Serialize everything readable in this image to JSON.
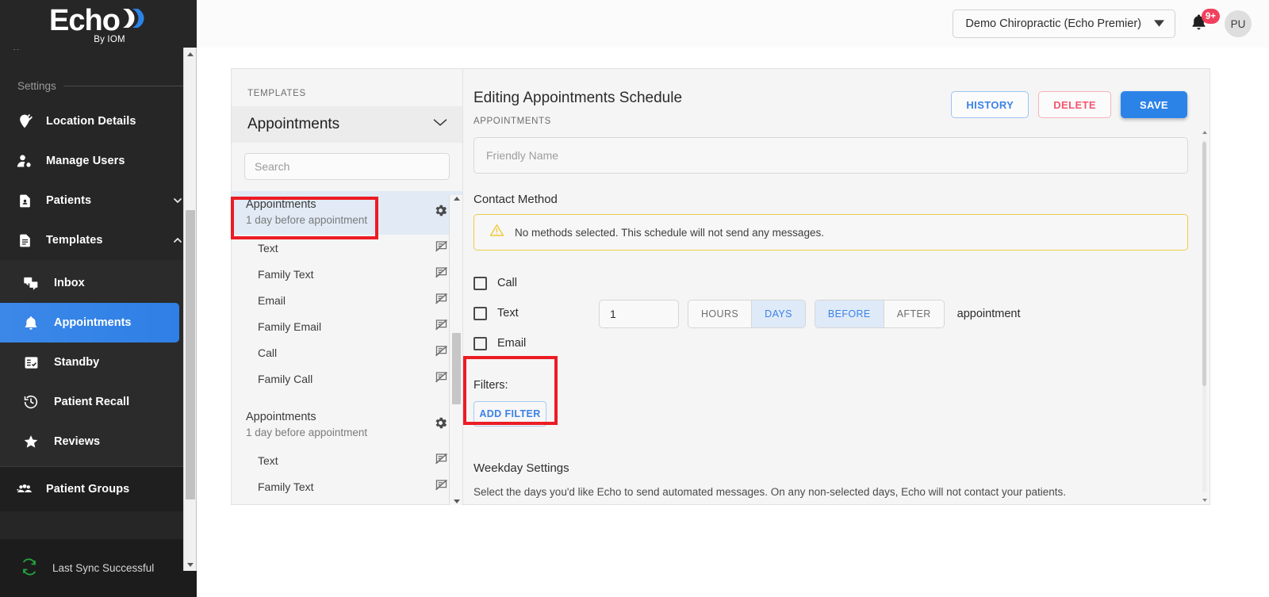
{
  "brand": {
    "logo_text": "Echo",
    "logo_sub": "By IOM",
    "accent_blue": "#2b83e8",
    "sidebar_bg": "#262626",
    "annotation_red": "#ec1c24",
    "warning_yellow": "#e9cd4a"
  },
  "sidebar": {
    "group_label": "Settings",
    "items": [
      {
        "label": "Location Details",
        "icon": "location-pin-edit-icon",
        "chevron": ""
      },
      {
        "label": "Manage Users",
        "icon": "user-gear-icon",
        "chevron": ""
      },
      {
        "label": "Patients",
        "icon": "patient-document-icon",
        "chevron": "chevron-down-icon"
      },
      {
        "label": "Templates",
        "icon": "template-document-icon",
        "chevron": "chevron-up-icon"
      }
    ],
    "sub_items": [
      {
        "label": "Inbox",
        "icon": "chat-bubbles-icon",
        "active": false
      },
      {
        "label": "Appointments",
        "icon": "bell-icon",
        "active": true
      },
      {
        "label": "Standby",
        "icon": "checklist-icon",
        "active": false
      },
      {
        "label": "Patient Recall",
        "icon": "history-clock-icon",
        "active": false
      },
      {
        "label": "Reviews",
        "icon": "star-icon",
        "active": false
      }
    ],
    "bottom_items": [
      {
        "label": "Patient Groups",
        "icon": "people-group-icon"
      }
    ],
    "footer": {
      "label": "Last Sync Successful",
      "icon": "sync-refresh-icon"
    }
  },
  "header": {
    "org_name": "Demo Chiropractic (Echo Premier)",
    "org_chevron": "chevron-down-icon",
    "bell_icon": "bell-icon",
    "notification_count": "9+",
    "avatar_initials": "PU"
  },
  "templates_panel": {
    "kicker": "TEMPLATES",
    "category": "Appointments",
    "category_chevron": "chevron-down-icon",
    "search_placeholder": "Search",
    "search_value": "",
    "groups": [
      {
        "title": "Appointments",
        "subtitle": "1 day before appointment",
        "gear_icon": "gear-icon",
        "selected": true,
        "children": [
          {
            "label": "Text",
            "icon": "speaker-notes-off-icon"
          },
          {
            "label": "Family Text",
            "icon": "speaker-notes-off-icon"
          },
          {
            "label": "Email",
            "icon": "speaker-notes-off-icon"
          },
          {
            "label": "Family Email",
            "icon": "speaker-notes-off-icon"
          },
          {
            "label": "Call",
            "icon": "speaker-notes-off-icon"
          },
          {
            "label": "Family Call",
            "icon": "speaker-notes-off-icon"
          }
        ]
      },
      {
        "title": "Appointments",
        "subtitle": "1 day before appointment",
        "gear_icon": "gear-icon",
        "selected": false,
        "children": [
          {
            "label": "Text",
            "icon": "speaker-notes-off-icon"
          },
          {
            "label": "Family Text",
            "icon": "speaker-notes-off-icon"
          }
        ]
      }
    ]
  },
  "main": {
    "title": "Editing Appointments Schedule",
    "kicker": "APPOINTMENTS",
    "buttons": {
      "history": "HISTORY",
      "delete": "DELETE",
      "save": "SAVE"
    },
    "friendly_name": {
      "placeholder": "Friendly Name",
      "value": ""
    },
    "contact_method_label": "Contact Method",
    "warning": {
      "icon": "warning-triangle-icon",
      "text": "No methods selected. This schedule will not send any messages."
    },
    "methods": [
      {
        "label": "Call",
        "checked": false
      },
      {
        "label": "Text",
        "checked": false
      },
      {
        "label": "Email",
        "checked": false
      }
    ],
    "timing": {
      "amount": "1",
      "unit_options": [
        "HOURS",
        "DAYS"
      ],
      "unit_selected": "DAYS",
      "direction_options": [
        "BEFORE",
        "AFTER"
      ],
      "direction_selected": "BEFORE",
      "suffix": "appointment"
    },
    "filters": {
      "label": "Filters:",
      "add_button": "ADD FILTER"
    },
    "weekday": {
      "title": "Weekday Settings",
      "description": "Select the days you'd like Echo to send automated messages. On any non-selected days, Echo will not contact your patients."
    }
  }
}
